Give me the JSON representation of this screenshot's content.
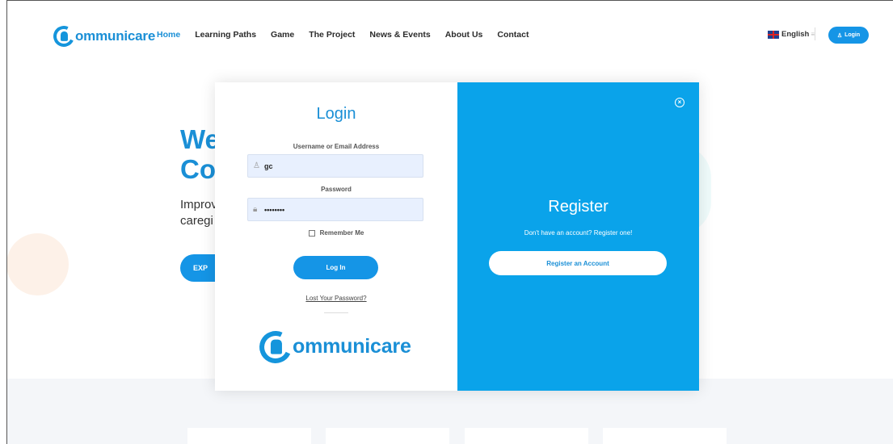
{
  "header": {
    "logo_text": "ommunicare",
    "nav": [
      "Home",
      "Learning Paths",
      "Game",
      "The Project",
      "News & Events",
      "About Us",
      "Contact"
    ],
    "language": "English",
    "login_label": "Login"
  },
  "hero": {
    "title_line1": "We",
    "title_line2": "Co",
    "sub_line1": "Improv",
    "sub_line2": "caregi",
    "button_label": "EXP"
  },
  "login": {
    "title": "Login",
    "username_label": "Username or Email Address",
    "username_value": "gc",
    "password_label": "Password",
    "password_value": "••••••••",
    "remember_label": "Remember Me",
    "submit_label": "Log In",
    "lost_password_label": "Lost Your Password?",
    "logo_text": "ommunicare"
  },
  "register": {
    "title": "Register",
    "subtitle": "Don't have an account? Register one!",
    "button_label": "Register an Account"
  },
  "colors": {
    "brand_blue": "#1595e6",
    "register_panel": "#0aa3ea",
    "input_bg": "#e8f0fe"
  }
}
